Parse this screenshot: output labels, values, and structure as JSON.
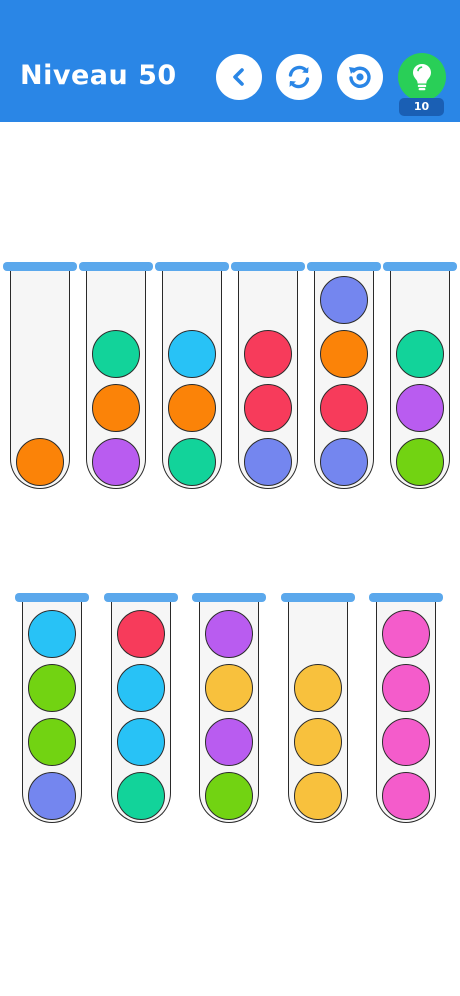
{
  "header": {
    "title": "Niveau 50",
    "buttons": {
      "back": "chevron-left-icon",
      "restart": "restart-icon",
      "undo": "undo-icon",
      "hint": "lightbulb-icon"
    },
    "hint_count": "10"
  },
  "colors": {
    "header_bg": "#2a86e6",
    "hint_button": "#29cf57",
    "hint_badge": "#1a5fb4",
    "tube_cap": "#5ba8ec",
    "orange": "#fb8308",
    "teal": "#12d39a",
    "purple": "#b95cf0",
    "sky": "#28c2f6",
    "red": "#f73b5b",
    "periwinkle": "#7486ef",
    "lime": "#72d312",
    "yellow": "#f8c13d",
    "pink": "#f45ccb"
  },
  "tubes": [
    [
      "orange"
    ],
    [
      "purple",
      "orange",
      "teal"
    ],
    [
      "teal",
      "orange",
      "sky"
    ],
    [
      "periwinkle",
      "red",
      "red"
    ],
    [
      "periwinkle",
      "red",
      "orange",
      "periwinkle"
    ],
    [
      "lime",
      "purple",
      "teal"
    ],
    [
      "periwinkle",
      "lime",
      "lime",
      "sky"
    ],
    [
      "teal",
      "sky",
      "sky",
      "red"
    ],
    [
      "lime",
      "purple",
      "yellow",
      "purple"
    ],
    [
      "yellow",
      "yellow",
      "yellow"
    ],
    [
      "pink",
      "pink",
      "pink",
      "pink"
    ]
  ]
}
